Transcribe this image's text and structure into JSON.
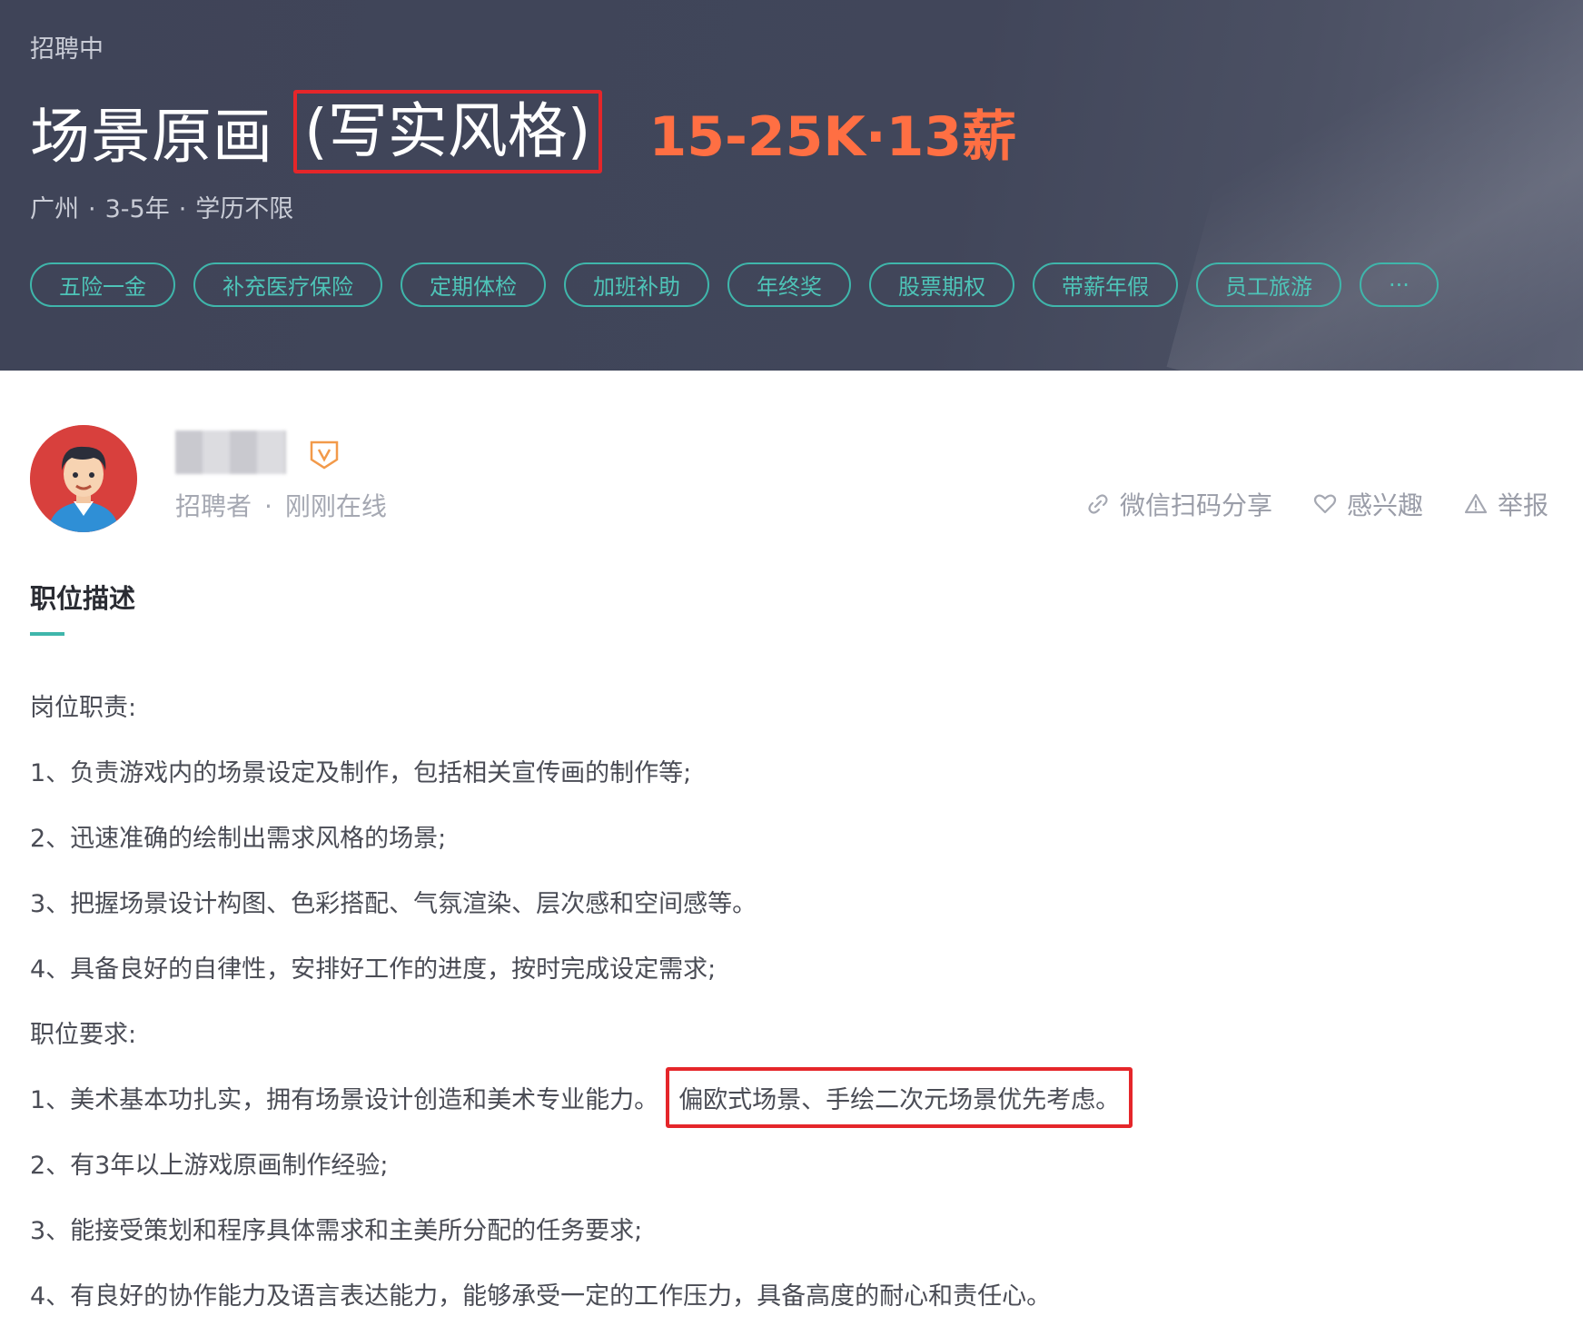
{
  "header": {
    "status": "招聘中",
    "title": "场景原画",
    "title_style": "(写实风格)",
    "salary": "15-25K·13薪",
    "meta": {
      "city": "广州",
      "experience": "3-5年",
      "education": "学历不限",
      "separator": "·"
    },
    "tags": [
      "五险一金",
      "补充医疗保险",
      "定期体检",
      "加班补助",
      "年终奖",
      "股票期权",
      "带薪年假",
      "员工旅游"
    ],
    "tags_more": "···"
  },
  "recruiter": {
    "role": "招聘者",
    "separator": "·",
    "online_status": "刚刚在线"
  },
  "actions": {
    "share": "微信扫码分享",
    "interest": "感兴趣",
    "report": "举报"
  },
  "description": {
    "section_title": "职位描述",
    "duties_heading": "岗位职责:",
    "duties": [
      "1、负责游戏内的场景设定及制作，包括相关宣传画的制作等;",
      "2、迅速准确的绘制出需求风格的场景;",
      "3、把握场景设计构图、色彩搭配、气氛渲染、层次感和空间感等。",
      "4、具备良好的自律性，安排好工作的进度，按时完成设定需求;"
    ],
    "requirements_heading": "职位要求:",
    "requirement_1": "1、美术基本功扎实，拥有场景设计创造和美术专业能力。",
    "requirement_1_highlight": "偏欧式场景、手绘二次元场景优先考虑。",
    "requirements": [
      "2、有3年以上游戏原画制作经验;",
      "3、能接受策划和程序具体需求和主美所分配的任务要求;",
      "4、有良好的协作能力及语言表达能力，能够承受一定的工作压力，具备高度的耐心和责任心。"
    ]
  },
  "colors": {
    "banner_bg": "#41465a",
    "salary": "#ff6f43",
    "tag_accent": "#3fb6ab",
    "highlight_box": "#e5262a",
    "badge": "#f29a4a"
  }
}
